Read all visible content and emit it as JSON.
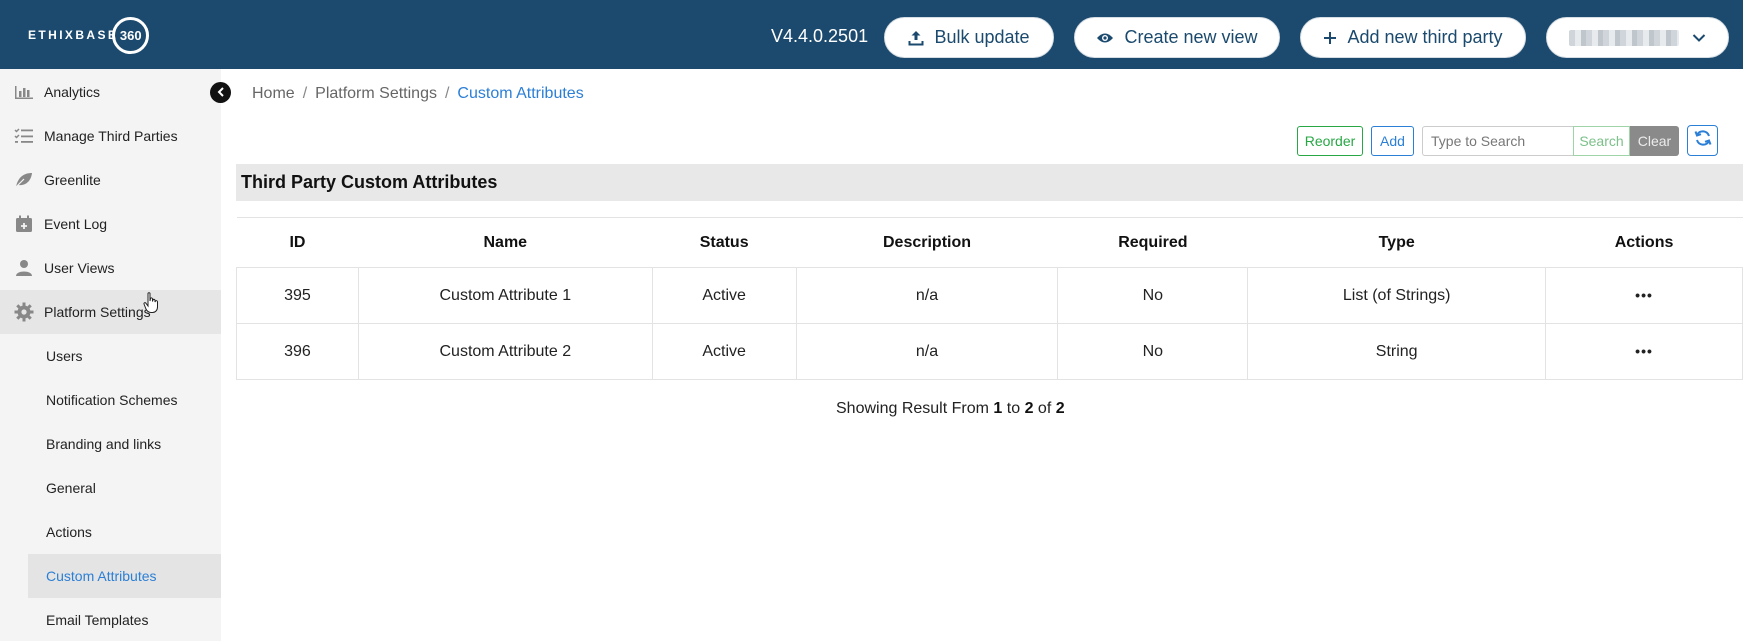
{
  "header": {
    "logo_text": "ETHIXBASE",
    "logo_number": "360",
    "version": "V4.4.0.2501",
    "bulk_update": "Bulk update",
    "create_view": "Create new view",
    "add_third_party": "Add new third party",
    "bg_color": "#1b4a6e"
  },
  "sidebar": {
    "items": [
      {
        "label": "Analytics",
        "icon": "bar-chart-icon"
      },
      {
        "label": "Manage Third Parties",
        "icon": "list-check-icon"
      },
      {
        "label": "Greenlite",
        "icon": "leaf-icon"
      },
      {
        "label": "Event Log",
        "icon": "calendar-plus-icon"
      },
      {
        "label": "User Views",
        "icon": "user-icon"
      },
      {
        "label": "Platform Settings",
        "icon": "gear-icon"
      }
    ],
    "sub_items": [
      {
        "label": "Users"
      },
      {
        "label": "Notification Schemes"
      },
      {
        "label": "Branding and links"
      },
      {
        "label": "General"
      },
      {
        "label": "Actions"
      },
      {
        "label": "Custom Attributes"
      },
      {
        "label": "Email Templates"
      }
    ]
  },
  "breadcrumb": {
    "home": "Home",
    "separator": "/",
    "settings": "Platform Settings",
    "current": "Custom Attributes"
  },
  "toolbar": {
    "reorder": "Reorder",
    "add": "Add",
    "search_placeholder": "Type to Search",
    "search": "Search",
    "clear": "Clear"
  },
  "section": {
    "title": "Third Party Custom Attributes"
  },
  "table": {
    "headers": [
      "ID",
      "Name",
      "Status",
      "Description",
      "Required",
      "Type",
      "Actions"
    ],
    "rows": [
      {
        "id": "395",
        "name": "Custom Attribute 1",
        "status": "Active",
        "description": "n/a",
        "required": "No",
        "type": "List (of Strings)",
        "actions": "•••"
      },
      {
        "id": "396",
        "name": "Custom Attribute 2",
        "status": "Active",
        "description": "n/a",
        "required": "No",
        "type": "String",
        "actions": "•••"
      }
    ]
  },
  "pagination": {
    "prefix": "Showing Result From",
    "from": "1",
    "to_word": "to",
    "to": "2",
    "of_word": "of",
    "total": "2"
  },
  "colors": {
    "accent_blue": "#2b7fd6",
    "green": "#28a745"
  }
}
